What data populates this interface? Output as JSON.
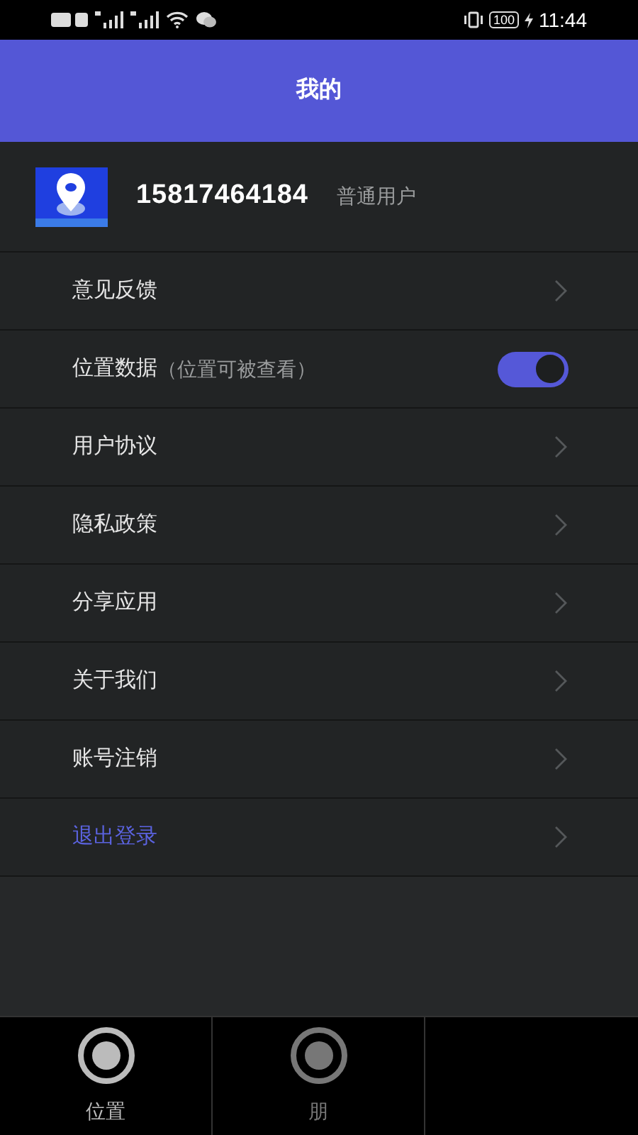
{
  "status_bar": {
    "battery": "100",
    "time": "11:44"
  },
  "header": {
    "title": "我的"
  },
  "profile": {
    "phone": "15817464184",
    "role": "普通用户"
  },
  "menu": [
    {
      "kind": "arrow",
      "label": "意见反馈",
      "highlight": false
    },
    {
      "kind": "toggle",
      "label": "位置数据",
      "note": "（位置可被查看）",
      "on": true,
      "highlight": false
    },
    {
      "kind": "arrow",
      "label": "用户协议",
      "highlight": false
    },
    {
      "kind": "arrow",
      "label": "隐私政策",
      "highlight": false
    },
    {
      "kind": "arrow",
      "label": "分享应用",
      "highlight": false
    },
    {
      "kind": "arrow",
      "label": "关于我们",
      "highlight": false
    },
    {
      "kind": "arrow",
      "label": "账号注销",
      "highlight": false
    },
    {
      "kind": "arrow",
      "label": "退出登录",
      "highlight": true
    }
  ],
  "tab_bar": [
    {
      "label": "位置",
      "selected": true
    },
    {
      "label": "朋",
      "selected": false
    }
  ]
}
